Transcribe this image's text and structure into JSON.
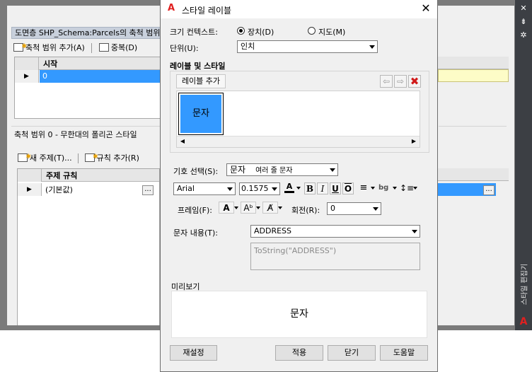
{
  "background": {
    "section1_title": "도면층 SHP_Schema:Parcels의 축척 범위",
    "toolbar1": {
      "add_range": "축척 범위 추가(A)",
      "duplicate": "중복(D)"
    },
    "grid1": {
      "col_start": "시작",
      "row_value": "0"
    },
    "section2_title": "축척 범위 0 - 무한대의 폴리곤 스타일",
    "toolbar2": {
      "new_theme": "새 주제(T)...",
      "add_rule": "규칙 추가(R)"
    },
    "grid2": {
      "col_theme_rule": "주제 규칙",
      "row_value": "(기본값)"
    },
    "side_panel_title": "스타일 편집기",
    "side_glyphs": [
      "✕",
      "⇟",
      "✲"
    ]
  },
  "dialog": {
    "title": "스타일 레이블",
    "app_logo": "A",
    "close_glyph": "✕",
    "size_context_label": "크기 컨텍스트:",
    "device_option": "장치(D)",
    "map_option": "지도(M)",
    "size_context_selected": "device",
    "unit_label": "단위(U):",
    "unit_value": "인치",
    "labels_styles_heading": "레이블 및 스타일",
    "add_label_button": "레이블 추가",
    "label_tile_text": "문자",
    "symbol_select_label": "기호 선택(S):",
    "symbol_select_value": "문자",
    "symbol_select_desc": "여러 줄 문자",
    "font_value": "Arial",
    "size_value": "0.1575",
    "frame_label": "프레임(F):",
    "rotation_label": "회전(R):",
    "rotation_value": "0",
    "text_content_label": "문자 내용(T):",
    "text_content_value": "ADDRESS",
    "expression_value": "ToString(\"ADDRESS\")",
    "preview_label": "미리보기",
    "preview_text": "문자",
    "reset_button": "재설정",
    "apply_button": "적용",
    "close_button": "닫기",
    "help_button": "도움말"
  },
  "colors": {
    "accent_blue": "#3399ff",
    "selection_yellow": "#fdfcc7",
    "delete_red": "#d01a1a",
    "app_red": "#e02020",
    "side_panel": "#3c3f44"
  }
}
